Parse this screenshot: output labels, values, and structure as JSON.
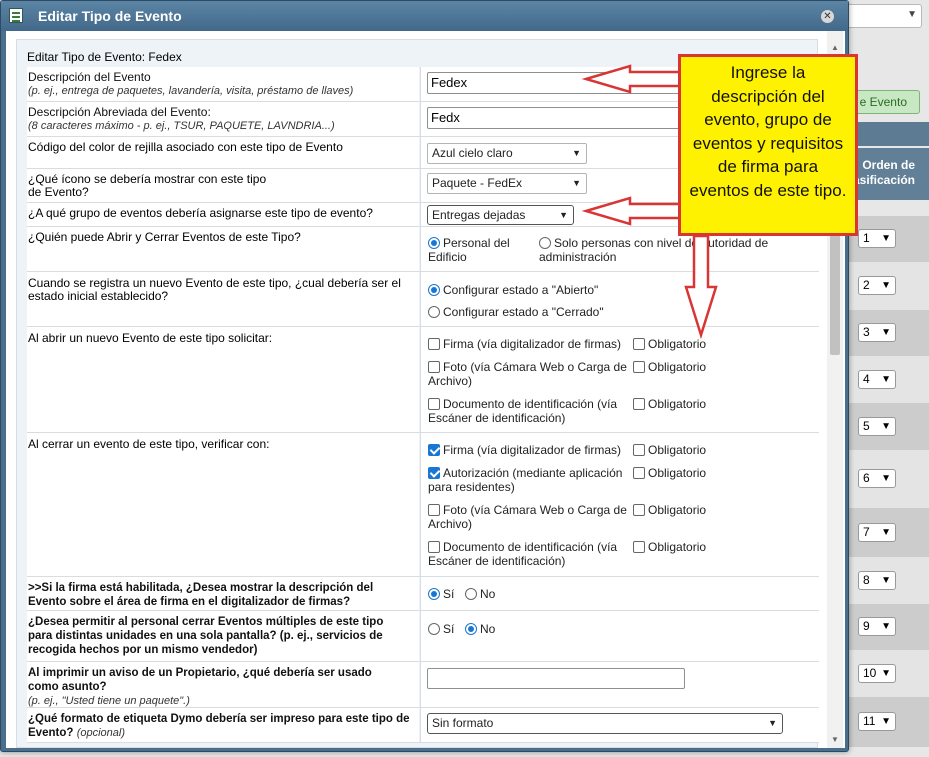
{
  "background": {
    "add_button_label": "e Evento",
    "column_header": "Orden de\nasificación",
    "order_values": [
      "1",
      "2",
      "3",
      "4",
      "5",
      "6",
      "7",
      "8",
      "9",
      "10",
      "11"
    ]
  },
  "dialog": {
    "title": "Editar Tipo de Evento",
    "close_icon": "close-icon"
  },
  "form": {
    "heading": "Editar Tipo de Evento: Fedex",
    "description": {
      "label": "Descripción del Evento",
      "hint": "(p. ej., entrega de paquetes, lavandería, visita, préstamo de llaves)",
      "value": "Fedex"
    },
    "short_description": {
      "label": "Descripción Abreviada del Evento:",
      "hint": "(8 caracteres máximo - p. ej., TSUR, PAQUETE, LAVNDRIA...)",
      "value": "Fedx"
    },
    "grid_color": {
      "label": "Código del color de rejilla asociado con este tipo de Evento",
      "value": "Azul cielo claro"
    },
    "icon": {
      "label": "¿Qué ícono se debería mostrar con este tipo de Evento?",
      "value": "Paquete - FedEx"
    },
    "group": {
      "label": "¿A qué grupo de eventos debería asignarse este tipo de evento?",
      "value": "Entregas dejadas"
    },
    "who_can_open": {
      "label": "¿Quién puede Abrir y Cerrar Eventos de este Tipo?",
      "option_1": "Personal del Edificio",
      "option_2": "Solo personas con nivel de autoridad de administración"
    },
    "initial_state": {
      "label": "Cuando se registra un nuevo Evento de este tipo, ¿cual debería ser el estado inicial establecido?",
      "option_1": "Configurar estado a \"Abierto\"",
      "option_2": "Configurar estado a \"Cerrado\""
    },
    "open_request": {
      "label": "Al abrir un nuevo Evento de este tipo solicitar:",
      "items": [
        "Firma (vía digitalizador de firmas)",
        "Foto (vía Cámara Web o Carga de Archivo)",
        "Documento de identificación (vía Escáner de identificación)"
      ],
      "required_label": "Obligatorio"
    },
    "close_verify": {
      "label": "Al cerrar un evento de este tipo, verificar con:",
      "items": [
        "Firma (vía digitalizador de firmas)",
        "Autorización (mediante aplicación para residentes)",
        "Foto (vía Cámara Web o Carga de Archivo)",
        "Documento de identificación (vía Escáner de identificación)"
      ],
      "required_label": "Obligatorio"
    },
    "show_desc_signature": {
      "label": ">>Si la firma está habilitada, ¿Desea mostrar la descripción del Evento sobre el área de firma en el digitalizador de firmas?",
      "yes": "Sí",
      "no": "No"
    },
    "multi_close": {
      "label": "¿Desea permitir al personal cerrar Eventos múltiples de este tipo para distintas unidades en una sola pantalla? (p. ej., servicios de recogida hechos por un mismo vendedor)",
      "yes": "Sí",
      "no": "No"
    },
    "print_subject": {
      "label": "Al imprimir un aviso de un Propietario, ¿qué debería ser usado como asunto?",
      "hint": "(p. ej., \"Usted tiene un paquete\".)",
      "value": ""
    },
    "dymo_format": {
      "label": "¿Qué formato de etiqueta Dymo debería ser impreso para este tipo de Evento?",
      "hint": "(opcional)",
      "value": "Sin formato"
    }
  },
  "callout": {
    "text": "Ingrese la descripción del evento, grupo de eventos y requisitos de firma para eventos de este tipo."
  },
  "colors": {
    "titlebar": "#4a6f8c",
    "callout_bg": "#fff200",
    "callout_border": "#d93535",
    "checkbox_on": "#1976d2"
  }
}
